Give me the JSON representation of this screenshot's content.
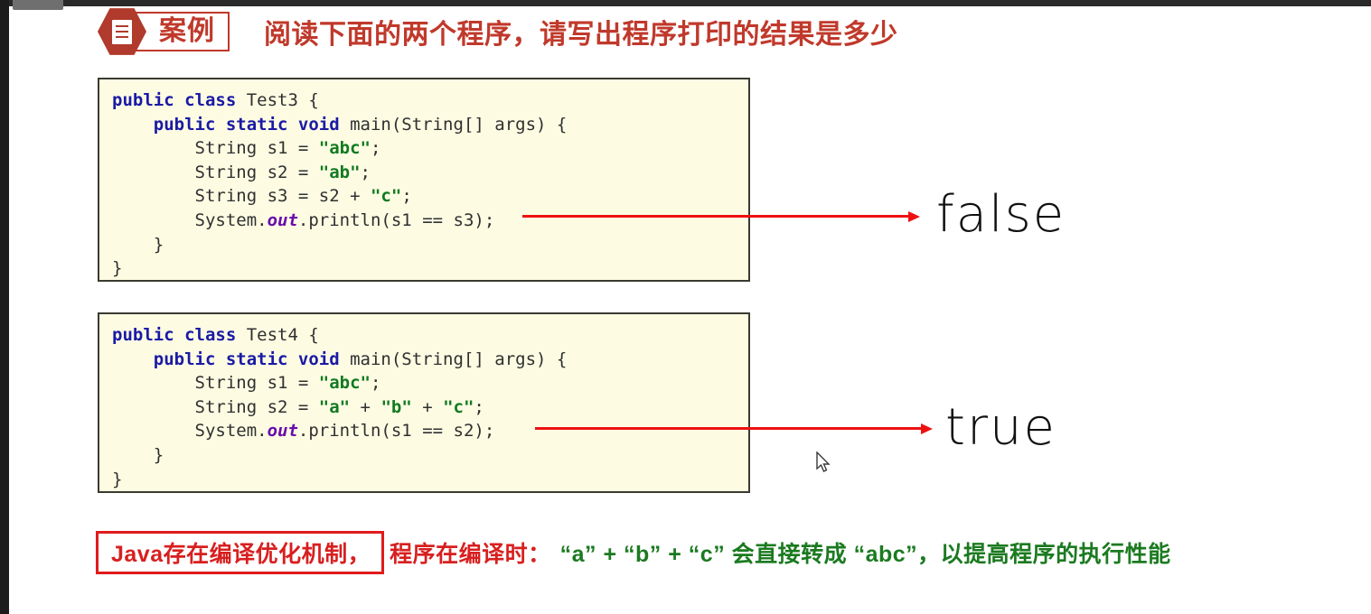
{
  "header": {
    "badge_icon": "document-icon",
    "badge_label": "案例",
    "title": "阅读下面的两个程序，请写出程序打印的结果是多少"
  },
  "code_blocks": [
    {
      "id": "test3",
      "lines": [
        [
          {
            "t": "public class ",
            "c": "kw"
          },
          {
            "t": "Test3 {",
            "c": ""
          }
        ],
        [
          {
            "t": "    ",
            "c": ""
          },
          {
            "t": "public static void ",
            "c": "kw"
          },
          {
            "t": "main(String[] args) {",
            "c": ""
          }
        ],
        [
          {
            "t": "        String s1 = ",
            "c": ""
          },
          {
            "t": "\"abc\"",
            "c": "str"
          },
          {
            "t": ";",
            "c": ""
          }
        ],
        [
          {
            "t": "        String s2 = ",
            "c": ""
          },
          {
            "t": "\"ab\"",
            "c": "str"
          },
          {
            "t": ";",
            "c": ""
          }
        ],
        [
          {
            "t": "        String s3 = s2 + ",
            "c": ""
          },
          {
            "t": "\"c\"",
            "c": "str"
          },
          {
            "t": ";",
            "c": ""
          }
        ],
        [
          {
            "t": "        System.",
            "c": ""
          },
          {
            "t": "out",
            "c": "field"
          },
          {
            "t": ".println(s1 == s3);",
            "c": ""
          }
        ],
        [
          {
            "t": "    }",
            "c": ""
          }
        ],
        [
          {
            "t": "}",
            "c": ""
          }
        ]
      ]
    },
    {
      "id": "test4",
      "lines": [
        [
          {
            "t": "public class ",
            "c": "kw"
          },
          {
            "t": "Test4 {",
            "c": ""
          }
        ],
        [
          {
            "t": "    ",
            "c": ""
          },
          {
            "t": "public static void ",
            "c": "kw"
          },
          {
            "t": "main(String[] args) {",
            "c": ""
          }
        ],
        [
          {
            "t": "        String s1 = ",
            "c": ""
          },
          {
            "t": "\"abc\"",
            "c": "str"
          },
          {
            "t": ";",
            "c": ""
          }
        ],
        [
          {
            "t": "        String s2 = ",
            "c": ""
          },
          {
            "t": "\"a\"",
            "c": "str"
          },
          {
            "t": " + ",
            "c": ""
          },
          {
            "t": "\"b\"",
            "c": "str"
          },
          {
            "t": " + ",
            "c": ""
          },
          {
            "t": "\"c\"",
            "c": "str"
          },
          {
            "t": ";",
            "c": ""
          }
        ],
        [
          {
            "t": "        System.",
            "c": ""
          },
          {
            "t": "out",
            "c": "field"
          },
          {
            "t": ".println(s1 == s2);",
            "c": ""
          }
        ],
        [
          {
            "t": "    }",
            "c": ""
          }
        ],
        [
          {
            "t": "}",
            "c": ""
          }
        ]
      ]
    }
  ],
  "answers": {
    "first": "false",
    "second": "true"
  },
  "footnote": {
    "boxed_text": "Java存在编译优化机制，",
    "red_text": "程序在编译时：",
    "green_text": "“a” + “b” + “c” 会直接转成 “abc”，以提高程序的执行性能"
  },
  "colors": {
    "accent_red": "#c0392b",
    "arrow_red": "#ee1111",
    "footnote_red": "#d81f1f",
    "footnote_green": "#1b7a20",
    "keyword_blue": "#1a1aa6",
    "string_green": "#127a21",
    "field_purple": "#6a0dad",
    "code_bg": "#fdfce3",
    "code_border": "#3a3a30"
  }
}
